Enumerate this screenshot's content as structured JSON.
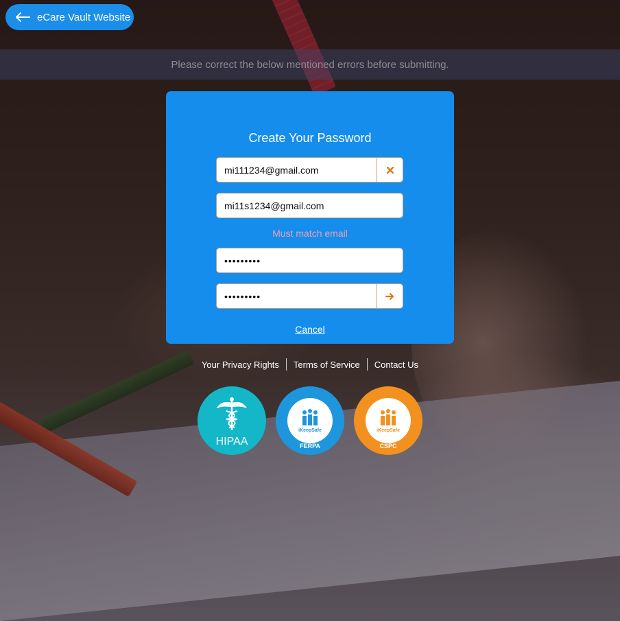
{
  "header": {
    "back_label": "eCare Vault Website"
  },
  "notice": {
    "error_message": "Please correct the below mentioned errors before submitting."
  },
  "form": {
    "title": "Create Your Password",
    "email": "mi111234@gmail.com",
    "confirm_email": "mi11s1234@gmail.com",
    "email_error": "Must match email",
    "password_mask": "•••••••••",
    "confirm_password_mask": "•••••••••",
    "cancel_label": "Cancel",
    "clear_icon": "close-icon",
    "submit_icon": "arrow-right-icon"
  },
  "footer": {
    "links": [
      "Your Privacy Rights",
      "Terms of Service",
      "Contact Us"
    ]
  },
  "badges": {
    "hipaa": "HIPAA",
    "ferpa": "FERPA",
    "cspc": "CSPC",
    "ikeepsafe": "iKeepSafe"
  },
  "colors": {
    "primary": "#148ded",
    "accent": "#e07a18",
    "error": "#f59bb0"
  }
}
